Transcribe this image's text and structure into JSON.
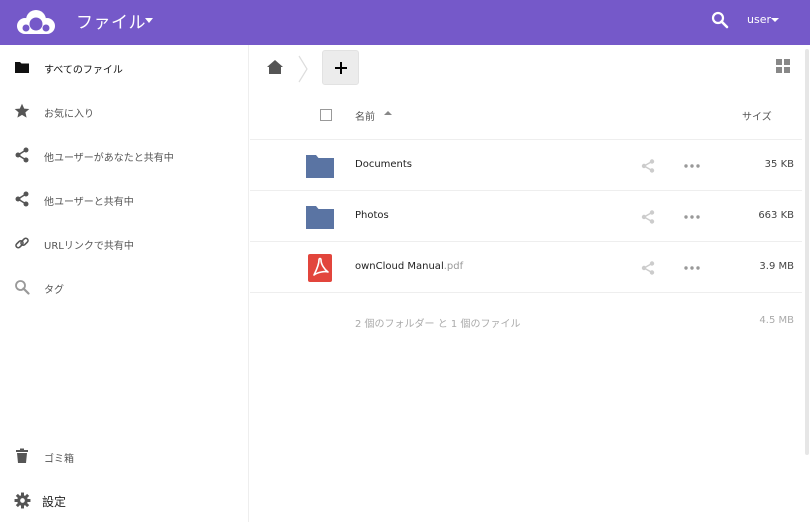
{
  "header": {
    "app_title": "ファイル",
    "user": "user",
    "brand_color": "#7559c9"
  },
  "sidebar": {
    "items": [
      {
        "label": "すべてのファイル",
        "icon": "folder-icon"
      },
      {
        "label": "お気に入り",
        "icon": "star-icon"
      },
      {
        "label": "他ユーザーがあなたと共有中",
        "icon": "share-icon"
      },
      {
        "label": "他ユーザーと共有中",
        "icon": "share-icon"
      },
      {
        "label": "URLリンクで共有中",
        "icon": "link-icon"
      },
      {
        "label": "タグ",
        "icon": "search-icon"
      }
    ],
    "trash_label": "ゴミ箱",
    "settings_label": "設定"
  },
  "table": {
    "name_header": "名前",
    "size_header": "サイズ",
    "files": [
      {
        "name": "Documents",
        "ext": "",
        "type": "folder",
        "size": "35 KB"
      },
      {
        "name": "Photos",
        "ext": "",
        "type": "folder",
        "size": "663 KB"
      },
      {
        "name": "ownCloud Manual",
        "ext": ".pdf",
        "type": "pdf",
        "size": "3.9 MB"
      }
    ],
    "summary": "2 個のフォルダー と 1 個のファイル",
    "summary_size": "4.5 MB"
  }
}
